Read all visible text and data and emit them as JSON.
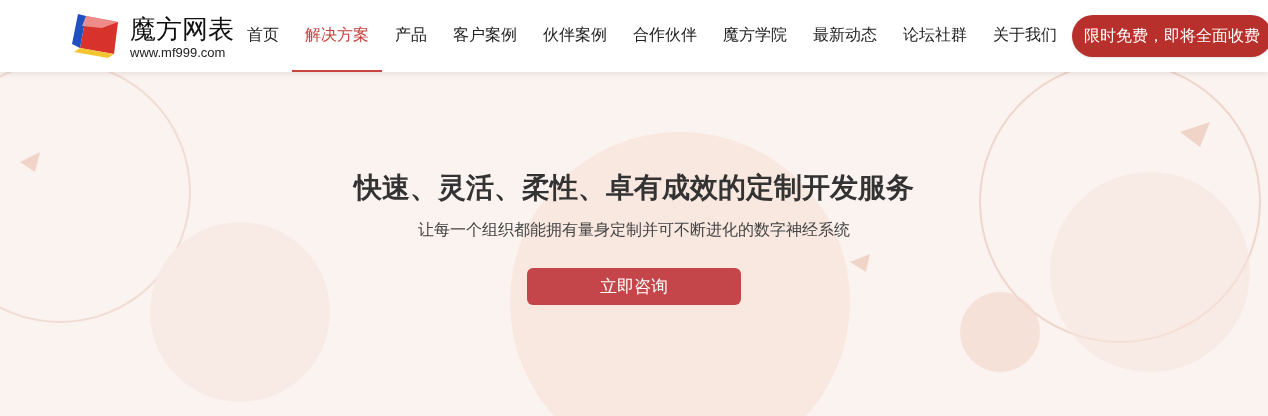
{
  "logo": {
    "name": "魔方网表",
    "url": "www.mf999.com"
  },
  "nav": [
    {
      "label": "首页",
      "selected": false
    },
    {
      "label": "解决方案",
      "selected": true
    },
    {
      "label": "产品",
      "selected": false
    },
    {
      "label": "客户案例",
      "selected": false
    },
    {
      "label": "伙伴案例",
      "selected": false
    },
    {
      "label": "合作伙伴",
      "selected": false
    },
    {
      "label": "魔方学院",
      "selected": false
    },
    {
      "label": "最新动态",
      "selected": false
    },
    {
      "label": "论坛社群",
      "selected": false
    },
    {
      "label": "关于我们",
      "selected": false
    }
  ],
  "promo_button": "限时免费，即将全面收费",
  "hero": {
    "title": "快速、灵活、柔性、卓有成效的定制开发服务",
    "subtitle": "让每一个组织都能拥有量身定制并可不断进化的数字神经系统",
    "cta": "立即咨询"
  }
}
